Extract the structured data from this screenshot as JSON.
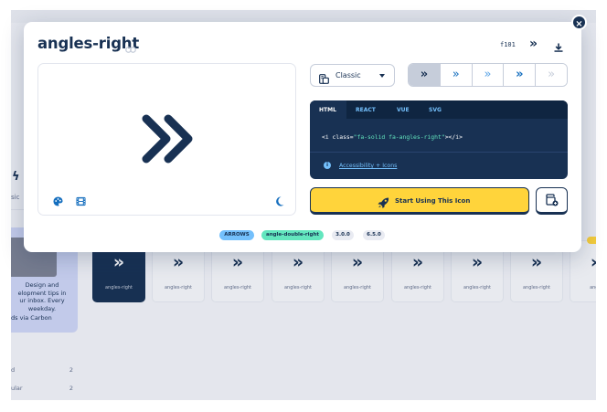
{
  "background": {
    "sidebar_label": "sic",
    "promo": {
      "text": "Design and\nelopment tips in\nur inbox. Every\nweekday.",
      "via": "ds via Carbon"
    },
    "filters": [
      {
        "label": "d",
        "count": "2"
      },
      {
        "label": "ular",
        "count": "2"
      }
    ],
    "tiles": [
      {
        "label": "angles-right",
        "active": true
      },
      {
        "label": "angles-right",
        "active": false
      },
      {
        "label": "angles-right",
        "active": false
      },
      {
        "label": "angles-right",
        "active": false
      },
      {
        "label": "angles-right",
        "active": false
      },
      {
        "label": "angles-right",
        "active": false
      },
      {
        "label": "angles-right",
        "active": false
      },
      {
        "label": "angles-right",
        "active": false
      },
      {
        "label": "angle",
        "active": false
      }
    ],
    "partial_badge": "P"
  },
  "modal": {
    "title": "angles-right",
    "unicode": "f101",
    "close_label": "×",
    "style_select": {
      "selected": "Classic"
    },
    "variants": [
      "»",
      "»",
      "»",
      "»",
      "»"
    ],
    "code_tabs": [
      "HTML",
      "REACT",
      "VUE",
      "SVG"
    ],
    "active_tab": "HTML",
    "code": {
      "prefix": "<i class=",
      "string": "\"fa-solid fa-angles-right\"",
      "suffix": "></i>"
    },
    "a11y_link": "Accessibility + Icons",
    "start_button": "Start Using This Icon",
    "tags": [
      "ARROWS",
      "angle-double-right",
      "3.0.0",
      "6.5.0"
    ]
  },
  "colors": {
    "navy": "#183153",
    "yellow": "#ffd43b",
    "blue": "#146ebe",
    "light_blue": "#74c0fc",
    "green": "#63e6be"
  }
}
